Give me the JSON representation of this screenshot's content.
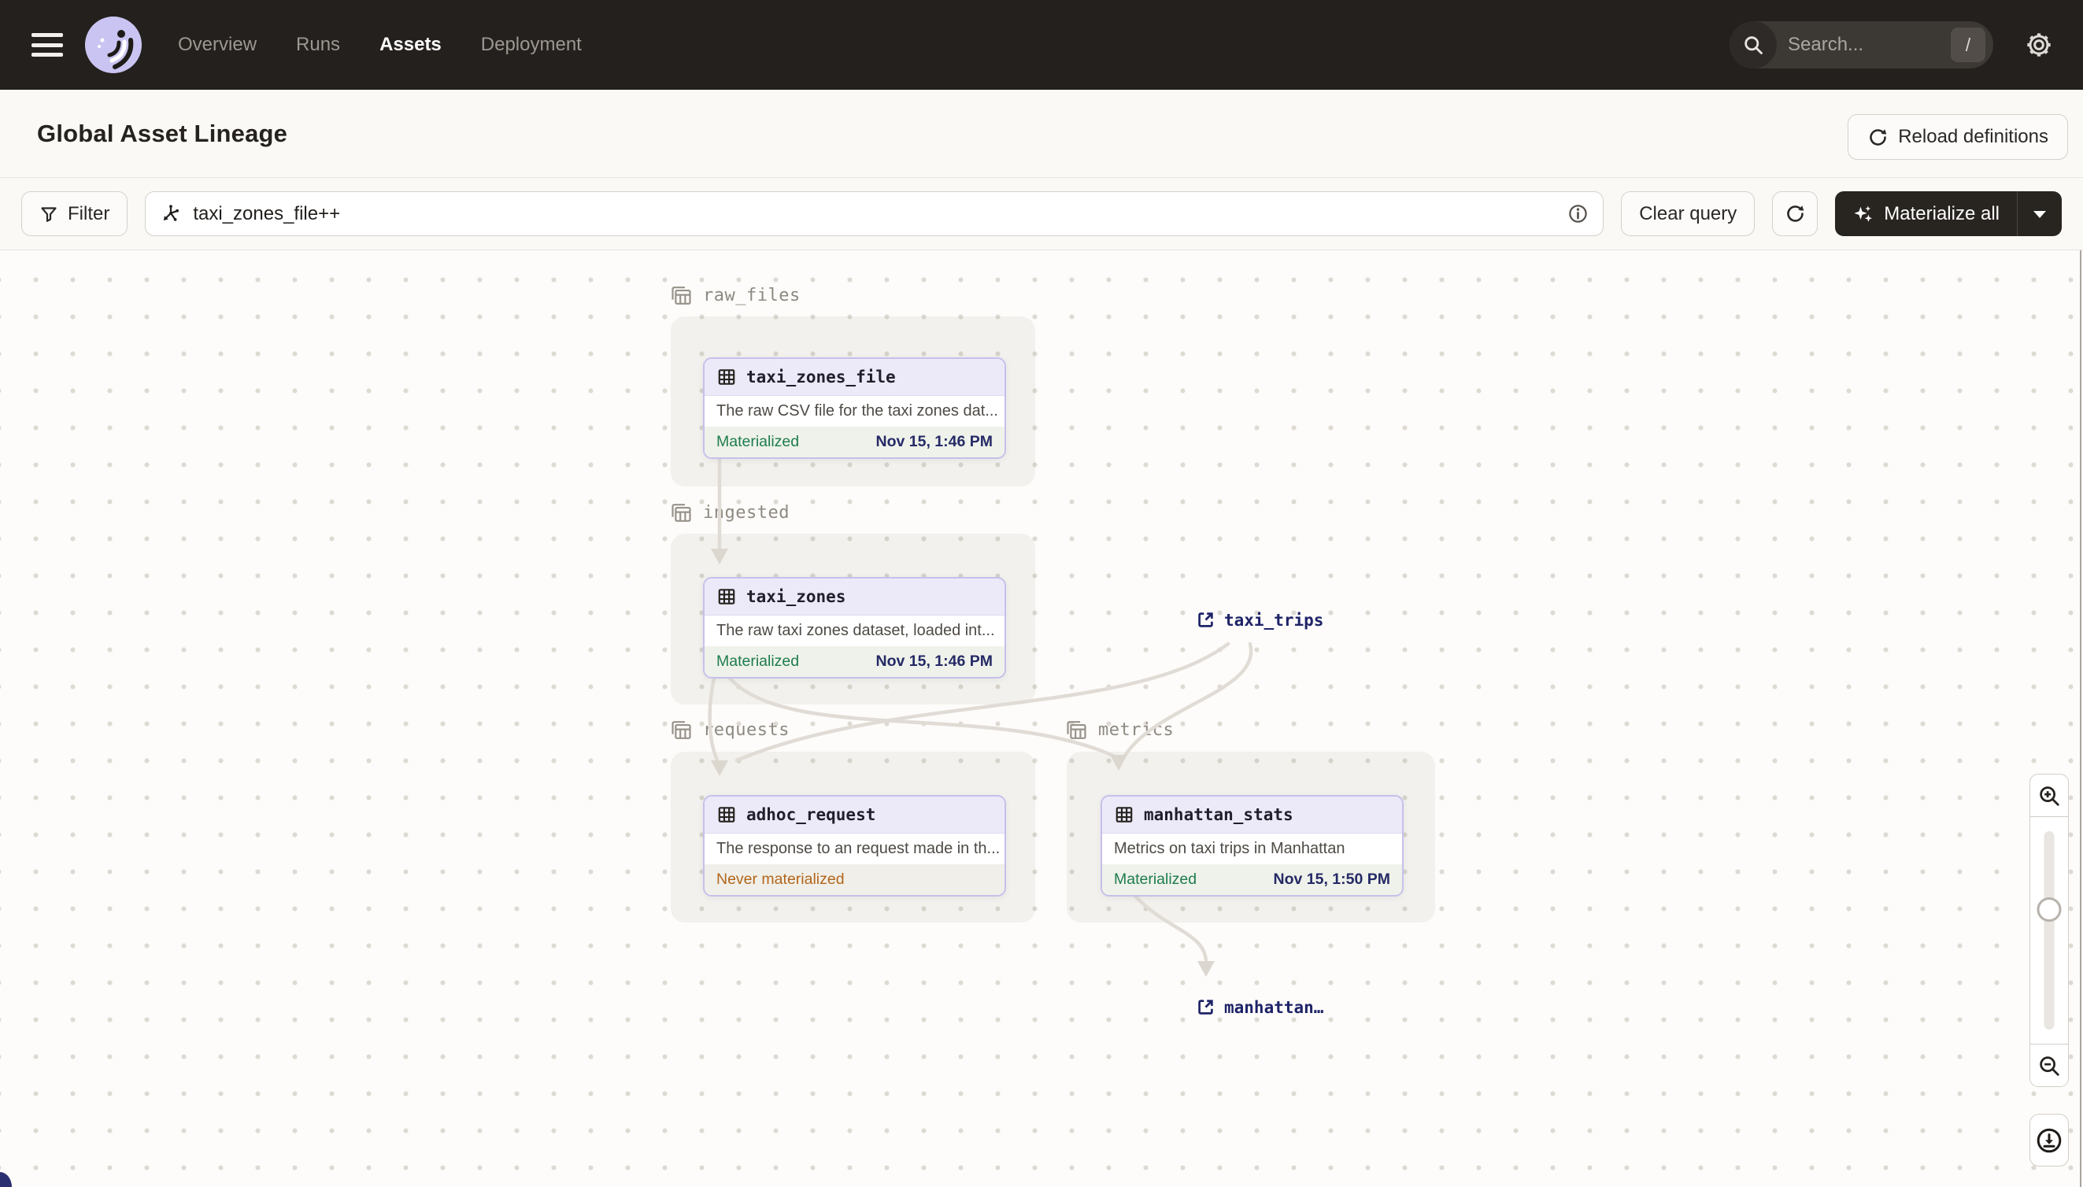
{
  "navbar": {
    "nav_items": [
      {
        "label": "Overview",
        "active": false
      },
      {
        "label": "Runs",
        "active": false
      },
      {
        "label": "Assets",
        "active": true
      },
      {
        "label": "Deployment",
        "active": false
      }
    ],
    "search_placeholder": "Search...",
    "search_shortcut": "/"
  },
  "header": {
    "title": "Global Asset Lineage",
    "reload_button_label": "Reload definitions"
  },
  "toolbar": {
    "filter_label": "Filter",
    "query_value": "taxi_zones_file++",
    "clear_query_label": "Clear query",
    "materialize_label": "Materialize all"
  },
  "graph": {
    "groups": [
      {
        "label": "raw_files"
      },
      {
        "label": "ingested"
      },
      {
        "label": "requests"
      },
      {
        "label": "metrics"
      }
    ],
    "nodes": [
      {
        "title": "taxi_zones_file",
        "description": "The raw CSV file for the taxi zones dat...",
        "status": "Materialized",
        "time": "Nov 15, 1:46 PM"
      },
      {
        "title": "taxi_zones",
        "description": "The raw taxi zones dataset, loaded int...",
        "status": "Materialized",
        "time": "Nov 15, 1:46 PM"
      },
      {
        "title": "adhoc_request",
        "description": "The response to an request made in th...",
        "status": "Never materialized",
        "time": ""
      },
      {
        "title": "manhattan_stats",
        "description": "Metrics on taxi trips in Manhattan",
        "status": "Materialized",
        "time": "Nov 15, 1:50 PM"
      }
    ],
    "external_assets": [
      {
        "label": "taxi_trips"
      },
      {
        "label": "manhattan…"
      }
    ]
  },
  "colors": {
    "navbar_bg": "#24201D",
    "accent_lavender": "#ECEAF9",
    "node_border": "#C6C0EB",
    "status_green": "#1E7C4E",
    "status_orange": "#B2661C",
    "timestamp_navy": "#252A66",
    "external_navy": "#1F2468",
    "edge_gray": "#E0DCD5"
  }
}
